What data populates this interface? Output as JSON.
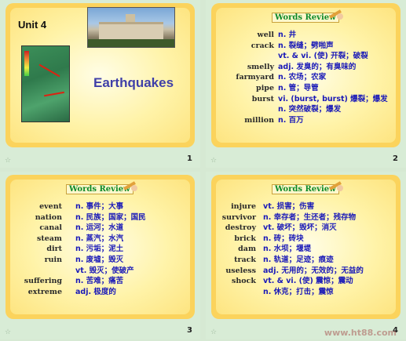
{
  "slides": [
    {
      "number": "1",
      "unit": "Unit 4",
      "title": "Earthquakes"
    },
    {
      "number": "2",
      "header": "Words Review",
      "entries": [
        {
          "word": "well",
          "def": "n. 井"
        },
        {
          "word": "crack",
          "def": "n. 裂缝；劈啪声"
        },
        {
          "word": "",
          "def": "vt. & vi. (使) 开裂；破裂"
        },
        {
          "word": "smelly",
          "def": "adj. 发臭的；有臭味的"
        },
        {
          "word": "farmyard",
          "def": "n. 农场；农家"
        },
        {
          "word": "pipe",
          "def": "n. 管；导管"
        },
        {
          "word": "burst",
          "def": "vi. (burst, burst) 爆裂；爆发"
        },
        {
          "word": "",
          "def": "n. 突然破裂；爆发"
        },
        {
          "word": "million",
          "def": "n. 百万"
        }
      ]
    },
    {
      "number": "3",
      "header": "Words Review",
      "entries": [
        {
          "word": "event",
          "def": "n. 事件；大事"
        },
        {
          "word": "nation",
          "def": "n. 民族；国家；国民"
        },
        {
          "word": "canal",
          "def": "n. 运河；水道"
        },
        {
          "word": "steam",
          "def": "n. 蒸汽；水汽"
        },
        {
          "word": "dirt",
          "def": "n. 污垢；泥土"
        },
        {
          "word": "ruin",
          "def": "n. 废墟；毁灭"
        },
        {
          "word": "",
          "def": "vt. 毁灭；使破产"
        },
        {
          "word": "suffering",
          "def": "n. 苦难；痛苦"
        },
        {
          "word": "extreme",
          "def": "adj. 极度的"
        }
      ]
    },
    {
      "number": "4",
      "header": "Words Review",
      "entries": [
        {
          "word": "injure",
          "def": "vt. 损害；伤害"
        },
        {
          "word": "survivor",
          "def": "n. 幸存者；生还者；残存物"
        },
        {
          "word": "destroy",
          "def": "vt. 破坏；毁坏；消灭"
        },
        {
          "word": "brick",
          "def": "n. 砖；砖块"
        },
        {
          "word": "dam",
          "def": "n. 水坝；堰堤"
        },
        {
          "word": "track",
          "def": "n. 轨道；足迹；痕迹"
        },
        {
          "word": "useless",
          "def": "adj. 无用的；无效的；无益的"
        },
        {
          "word": "shock",
          "def": "vt. & vi. (使) 震惊；震动"
        },
        {
          "word": "",
          "def": "n. 休克；打击；震惊"
        }
      ]
    }
  ],
  "watermark": {
    "text": "育星教育网",
    "url": "www.ht88.com"
  },
  "colors": {
    "panel": "#fbd35c",
    "title": "#3f3fa8",
    "definition": "#1a1ab8",
    "badge": "#0e8a2a",
    "background": "#d6e9d3"
  }
}
